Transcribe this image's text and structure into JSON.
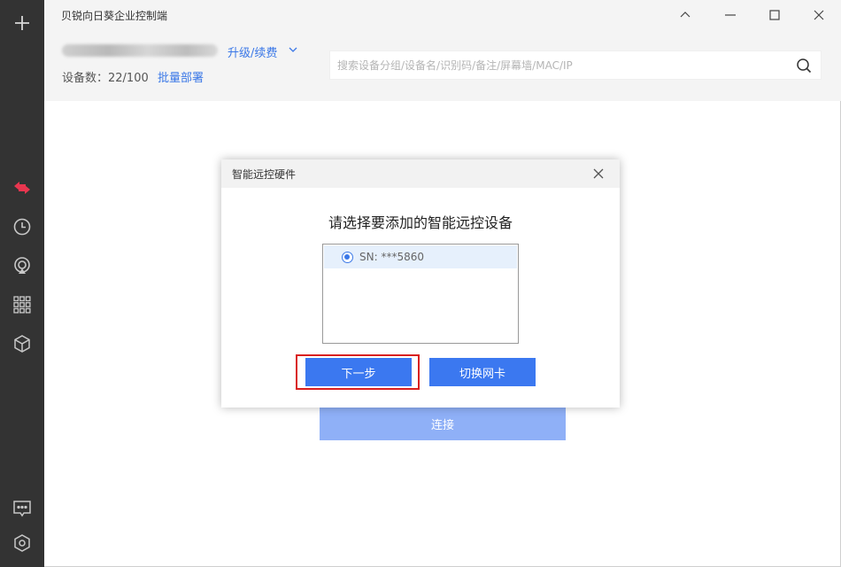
{
  "app": {
    "title": "贝锐向日葵企业控制端",
    "upgrade_label": "升级/续费",
    "device_count": "设备数：22/100",
    "batch_deploy": "批量部署"
  },
  "search": {
    "placeholder": "搜索设备分组/设备名/识别码/备注/屏幕墙/MAC/IP"
  },
  "background": {
    "connect_label": "连接"
  },
  "dialog": {
    "title": "智能远控硬件",
    "heading": "请选择要添加的智能远控设备",
    "devices": [
      {
        "label": "SN: ***5860",
        "selected": true
      }
    ],
    "next_label": "下一步",
    "switch_nic_label": "切换网卡"
  },
  "colors": {
    "sidebar": "#333333",
    "accent": "#3b78e7",
    "active_icon": "#e8364f",
    "highlight": "#d9201f"
  },
  "icons": {
    "sidebar": [
      "plus-icon",
      "remote-control-icon",
      "history-icon",
      "remote-assist-icon",
      "device-grid-icon",
      "cube-icon",
      "message-icon",
      "settings-icon"
    ],
    "window": [
      "minimize-icon",
      "restore-icon",
      "maximize-icon",
      "close-icon"
    ]
  }
}
